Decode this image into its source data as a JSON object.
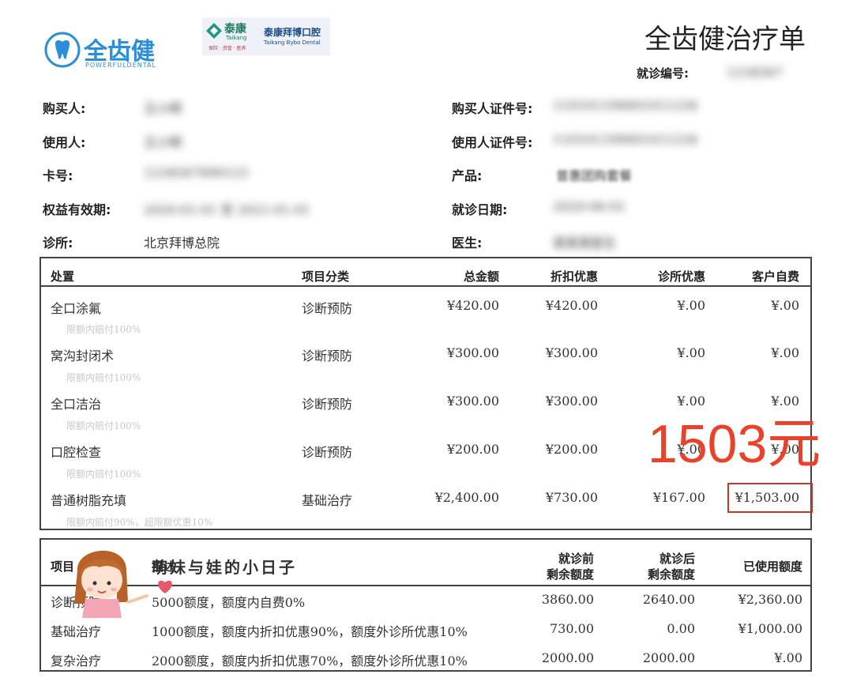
{
  "logos": {
    "brand1_text": "全齿健",
    "brand1_sub": "POWERFULDENTAL",
    "brand2_cn": "泰康",
    "brand2_en": "Taikang",
    "brand2_tag": "保险 · 资管 · 医养",
    "brand3_cn": "泰康拜博口腔",
    "brand3_en": "Taikang Bybo Dental"
  },
  "doc": {
    "title": "全齿健治疗单",
    "visit_no_label": "就诊编号:",
    "visit_no_value": "1234567"
  },
  "info": {
    "buyer_label": "购买人:",
    "buyer_value": "王小明",
    "buyer_id_label": "购买人证件号:",
    "buyer_id_value": "110101199001011234",
    "user_label": "使用人:",
    "user_value": "王小明",
    "user_id_label": "使用人证件号:",
    "user_id_value": "110101199001011234",
    "card_label": "卡号:",
    "card_value": "1234567890123",
    "product_label": "产品:",
    "product_value": "普惠团购套餐",
    "validity_label": "权益有效期:",
    "validity_value": "2020-01-01 至 2021-01-01",
    "visit_date_label": "就诊日期:",
    "visit_date_value": "2020-06-01",
    "clinic_label": "诊所:",
    "clinic_value": "北京拜博总院",
    "doctor_label": "医生:",
    "doctor_value": "某某某医生"
  },
  "treatment_table": {
    "headers": [
      "处置",
      "项目分类",
      "总金额",
      "折扣优惠",
      "诊所优惠",
      "客户自费"
    ],
    "rows": [
      {
        "name": "全口涂氟",
        "category": "诊断预防",
        "total": "¥420.00",
        "discount": "¥420.00",
        "clinic": "¥.00",
        "self": "¥.00",
        "note": "限额内赔付100%"
      },
      {
        "name": "窝沟封闭术",
        "category": "诊断预防",
        "total": "¥300.00",
        "discount": "¥300.00",
        "clinic": "¥.00",
        "self": "¥.00",
        "note": "限额内赔付100%"
      },
      {
        "name": "全口洁治",
        "category": "诊断预防",
        "total": "¥300.00",
        "discount": "¥300.00",
        "clinic": "¥.00",
        "self": "¥.00",
        "note": "限额内赔付100%"
      },
      {
        "name": "口腔检查",
        "category": "诊断预防",
        "total": "¥200.00",
        "discount": "¥200.00",
        "clinic": "¥.00",
        "self": "¥.00",
        "note": "限额内赔付100%"
      },
      {
        "name": "普通树脂充填",
        "category": "基础治疗",
        "total": "¥2,400.00",
        "discount": "¥730.00",
        "clinic": "¥167.00",
        "self": "¥1,503.00",
        "note": "限额内赔付90%，超限额优惠10%"
      }
    ]
  },
  "annotation": {
    "big_text": "1503元",
    "color": "#e8432a"
  },
  "quota_table": {
    "headers": {
      "project": "项目",
      "desc": "描述",
      "before_line1": "就诊前",
      "before_line2": "剩余额度",
      "after_line1": "就诊后",
      "after_line2": "剩余额度",
      "used": "已使用额度"
    },
    "rows": [
      {
        "name": "诊断预防",
        "desc": "5000额度，额度内自费0%",
        "before": "3860.00",
        "after": "2640.00",
        "used": "¥2,360.00"
      },
      {
        "name": "基础治疗",
        "desc": "1000额度，额度内折扣优惠90%，额度外诊所优惠10%",
        "before": "730.00",
        "after": "0.00",
        "used": "¥1,000.00"
      },
      {
        "name": "复杂治疗",
        "desc": "2000额度，额度内折扣优惠70%，额度外诊所优惠10%",
        "before": "2000.00",
        "after": "2000.00",
        "used": "¥.00"
      }
    ]
  },
  "watermark": {
    "name": "萌妹与娃的小日子"
  }
}
